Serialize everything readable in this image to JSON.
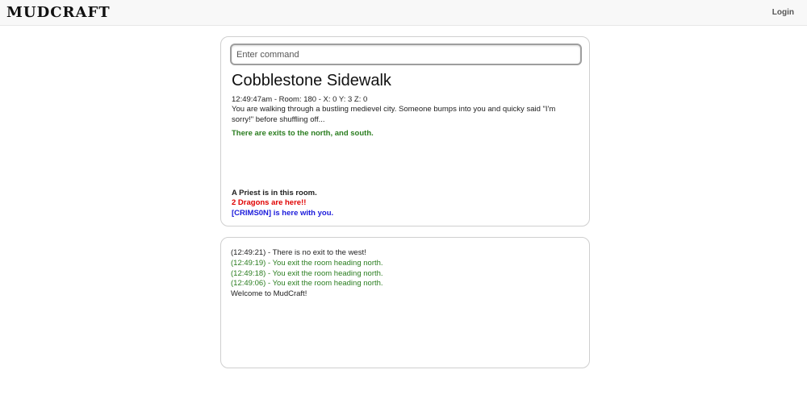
{
  "navbar": {
    "brand": "MUDCRAFT",
    "login_label": "Login"
  },
  "command": {
    "placeholder": "Enter command",
    "value": ""
  },
  "room": {
    "title": "Cobblestone Sidewalk",
    "meta": "12:49:47am - Room: 180 - X: 0 Y: 3 Z: 0",
    "description": "You are walking through a bustling medievel city. Someone bumps into you and quicky said \"I'm sorry!\" before shuffling off...",
    "exits": "There are exits to the north, and south.",
    "occupants": [
      {
        "text": "A Priest is in this room.",
        "color": "#222222"
      },
      {
        "text": "2 Dragons are here!!",
        "color": "#e00000"
      },
      {
        "text": "[CRIMS0N] is here with you.",
        "color": "#1a1adb"
      }
    ]
  },
  "log": [
    {
      "text": "(12:49:21) - There is no exit to the west!",
      "kind": "normal"
    },
    {
      "text": "(12:49:19) - You exit the room heading north.",
      "kind": "green"
    },
    {
      "text": "(12:49:18) - You exit the room heading north.",
      "kind": "green"
    },
    {
      "text": "(12:49:06) - You exit the room heading north.",
      "kind": "green"
    },
    {
      "text": "Welcome to MudCraft!",
      "kind": "normal"
    }
  ],
  "colors": {
    "exit_green": "#2a7d1f",
    "enemy_red": "#e00000",
    "player_blue": "#1a1adb"
  }
}
